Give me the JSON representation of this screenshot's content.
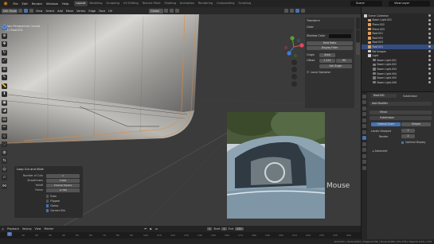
{
  "topbar": {
    "menus": [
      "File",
      "Edit",
      "Render",
      "Window",
      "Help"
    ],
    "workspaces": [
      "Layout",
      "Modeling",
      "Sculpting",
      "UV Editing",
      "Texture Paint",
      "Shading",
      "Animation",
      "Rendering",
      "Compositing",
      "Scripting"
    ],
    "active_workspace": "Layout",
    "scene": "Scene",
    "view_layer": "View Layer"
  },
  "viewport": {
    "mode": "Edit Mode",
    "menus": [
      "View",
      "Select",
      "Add",
      "Mesh",
      "Vertex",
      "Edge",
      "Face",
      "UV"
    ],
    "orientation": "Global",
    "info_line1": "User Perspective (Local)",
    "info_line2": "(1) Roof.001"
  },
  "npanel": {
    "title": "Transform",
    "color_label": "Color",
    "shadow_label": "Shadow Color",
    "field1": "Field Ratio",
    "field2": "Display Filter",
    "origin_label": "Origin",
    "origin_value": "Area",
    "offset_label": "Offset",
    "offset_val": "1.151",
    "offset_val2": "90",
    "set_origin": "Set Origin",
    "local_camera": "Local Operator"
  },
  "redo_panel": {
    "title": "Loop Cut and Slide",
    "rows": [
      {
        "label": "Number of Cuts",
        "value": "1"
      },
      {
        "label": "Smoothness",
        "value": "0.000"
      },
      {
        "label": "Falloff",
        "value": "Inverse Square"
      },
      {
        "label": "Factor",
        "value": "-0.789"
      }
    ],
    "checks": [
      {
        "label": "Even",
        "on": false
      },
      {
        "label": "Flipped",
        "on": false
      },
      {
        "label": "Clamp",
        "on": true
      },
      {
        "label": "Correct UVs",
        "on": true
      }
    ]
  },
  "overlay": {
    "mouse_label": "Mouse"
  },
  "timeline": {
    "menus": [
      "Playback",
      "Keying",
      "View",
      "Marker"
    ],
    "current_frame": "1",
    "start_label": "Start",
    "start": "1",
    "end_label": "End",
    "end": "250",
    "ruler": [
      "0",
      "10",
      "20",
      "30",
      "40",
      "50",
      "60",
      "70",
      "80",
      "90",
      "100",
      "110",
      "120",
      "130",
      "140",
      "150",
      "160",
      "170",
      "180",
      "190",
      "200",
      "210",
      "220",
      "230",
      "240",
      "250"
    ]
  },
  "status": {
    "right": "Roof.001 | Verts:0/402 | Edges:0/790 | Faces:0/389 | Tris:778 | Objects:1/24 | 2.83"
  },
  "outliner": {
    "rows": [
      {
        "label": "Scene Collection",
        "color": "#cfcfcf",
        "sel": false
      },
      {
        "label": "Boom Light.001",
        "color": "#e0a060",
        "sel": false
      },
      {
        "label": "Plane.002",
        "color": "#e0a060",
        "sel": false
      },
      {
        "label": "Plane.003",
        "color": "#e0a060",
        "sel": false
      },
      {
        "label": "Roof.001",
        "color": "#e0a060",
        "sel": false
      },
      {
        "label": "Roof.002",
        "color": "#e0a060",
        "sel": false
      },
      {
        "label": "Roof.003",
        "color": "#e0a060",
        "sel": false
      },
      {
        "label": "Roof.001",
        "color": "#e0a060",
        "sel": true
      },
      {
        "label": "Ref Images",
        "color": "#cfcfcf",
        "sel": false
      },
      {
        "label": "Light",
        "color": "#cfcfcf",
        "sel": false
      },
      {
        "label": "Boom Light.001",
        "color": "#7a7a7a",
        "sel": false
      },
      {
        "label": "Boom Light.002",
        "color": "#7a7a7a",
        "sel": false
      },
      {
        "label": "Boom Light.003",
        "color": "#7a7a7a",
        "sel": false
      },
      {
        "label": "Boom Light.004",
        "color": "#7a7a7a",
        "sel": false
      },
      {
        "label": "Boom Light.005",
        "color": "#7a7a7a",
        "sel": false
      },
      {
        "label": "Boom Light.006",
        "color": "#7a7a7a",
        "sel": false
      }
    ]
  },
  "properties": {
    "object_name": "Roof.001",
    "modifier_target": "Subdivision",
    "add_modifier": "Add Modifier",
    "mirror_label": "Mirror",
    "subsurf_label": "Subdivision",
    "catmull": "Catmull-Clark",
    "simple": "Simple",
    "levels_viewport_label": "Levels Viewport",
    "levels_viewport": "1",
    "render_label": "Render",
    "render": "2",
    "optimal_display": "Optimal Display",
    "advanced": "Advanced"
  },
  "colors": {
    "accent": "#4772b3",
    "brand": "#e87d0d"
  }
}
